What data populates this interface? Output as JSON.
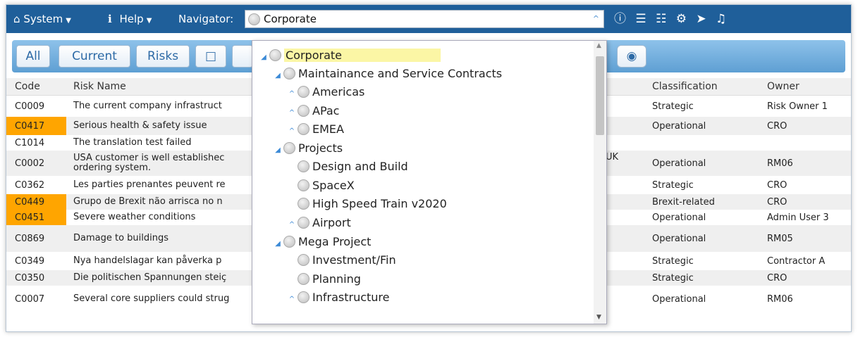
{
  "menubar": {
    "system_label": "System",
    "help_label": "Help",
    "navigator_label": "Navigator:",
    "navigator_value": "Corporate"
  },
  "toolbar": {
    "all_label": "All",
    "current_label": "Current",
    "risks_label": "Risks"
  },
  "table": {
    "headers": {
      "code": "Code",
      "risk_name": "Risk Name",
      "classification": "Classification",
      "owner": "Owner"
    },
    "rows": [
      {
        "code": "C0009",
        "name": "The current company infrastruct",
        "loc": "",
        "classification": "Strategic",
        "owner": "Risk Owner 1"
      },
      {
        "code": "C0417",
        "name": "Serious health & safety issue",
        "loc": "",
        "classification": "Operational",
        "owner": "CRO"
      },
      {
        "code": "C1014",
        "name": "The translation test failed",
        "loc": "",
        "classification": "",
        "owner": ""
      },
      {
        "code": "C0002",
        "name": "USA customer is well establishec",
        "name2": "ordering system.",
        "loc": "UK",
        "classification": "Operational",
        "owner": "RM06"
      },
      {
        "code": "C0362",
        "name": "Les parties prenantes peuvent re",
        "loc": "",
        "classification": "Strategic",
        "owner": "CRO"
      },
      {
        "code": "C0449",
        "name": "Grupo de Brexit não arrisca no n",
        "loc": "",
        "classification": "Brexit-related",
        "owner": "CRO"
      },
      {
        "code": "C0451",
        "name": "Severe weather conditions",
        "loc": "",
        "classification": "Operational",
        "owner": "Admin User 3"
      },
      {
        "code": "C0869",
        "name": "Damage to buildings",
        "loc": "",
        "classification": "Operational",
        "owner": "RM05"
      },
      {
        "code": "C0349",
        "name": "Nya handelslagar kan påverka p",
        "loc": "",
        "classification": "Strategic",
        "owner": "Contractor A"
      },
      {
        "code": "C0350",
        "name": "Die politischen Spannungen steiç",
        "loc": "",
        "classification": "Strategic",
        "owner": "CRO"
      },
      {
        "code": "C0007",
        "name": "Several core suppliers could strug",
        "loc": "",
        "classification": "Operational",
        "owner": "RM06"
      }
    ]
  },
  "tree": [
    {
      "label": "Corporate",
      "selected": true
    },
    {
      "label": "Maintainance and Service Contracts"
    },
    {
      "label": "Americas"
    },
    {
      "label": "APac"
    },
    {
      "label": "EMEA"
    },
    {
      "label": "Projects"
    },
    {
      "label": "Design and Build"
    },
    {
      "label": "SpaceX"
    },
    {
      "label": "High Speed Train v2020"
    },
    {
      "label": "Airport"
    },
    {
      "label": "Mega Project"
    },
    {
      "label": "Investment/Fin"
    },
    {
      "label": "Planning"
    },
    {
      "label": "Infrastructure"
    }
  ],
  "colors": {
    "menubar": "#1f5f9a",
    "highlight_code": "#ffa500",
    "selected_node": "#fbf6a5"
  }
}
